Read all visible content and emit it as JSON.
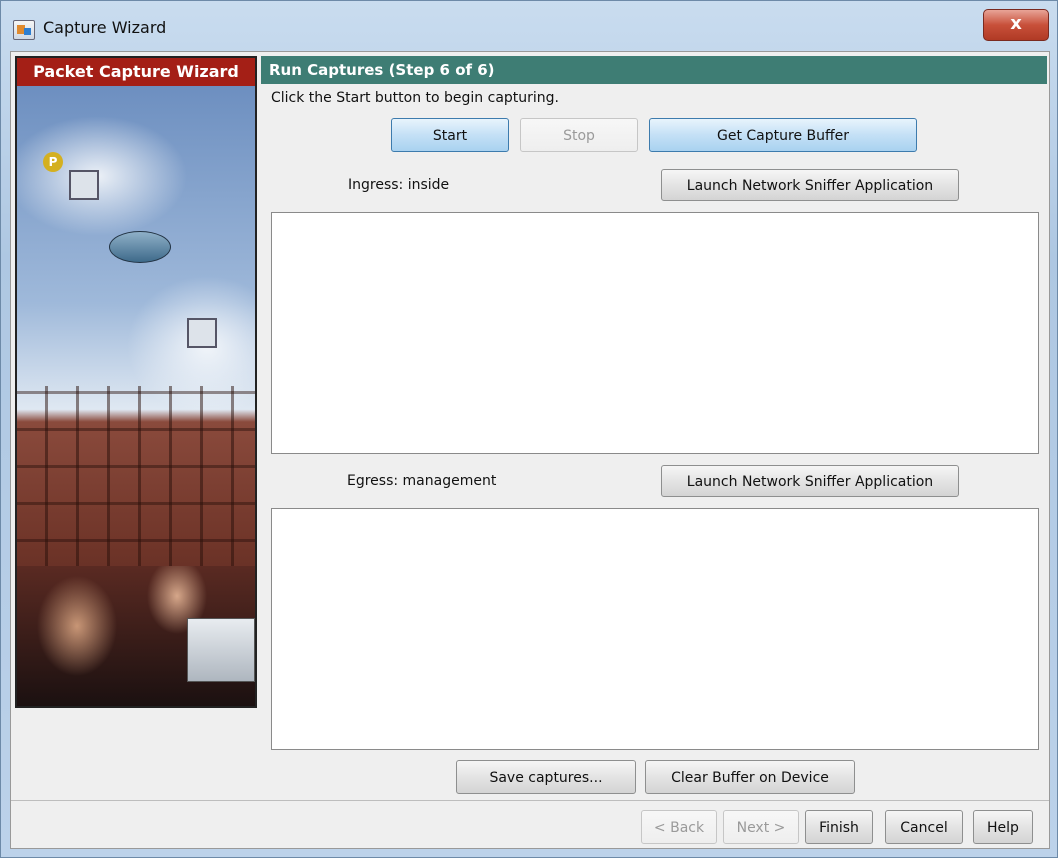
{
  "window": {
    "title": "Capture Wizard",
    "close_glyph": "x"
  },
  "left_panel": {
    "header": "Packet Capture Wizard",
    "node_badge": "P"
  },
  "step": {
    "header": "Run Captures  (Step 6 of 6)",
    "instruction": "Click the Start button to begin capturing."
  },
  "controls": {
    "start": "Start",
    "stop": "Stop",
    "get_buffer": "Get Capture Buffer"
  },
  "ingress": {
    "label": "Ingress: inside",
    "launch": "Launch Network Sniffer Application"
  },
  "egress": {
    "label": "Egress: management",
    "launch": "Launch Network Sniffer Application"
  },
  "actions": {
    "save": "Save captures...",
    "clear": "Clear Buffer on Device"
  },
  "footer": {
    "back": "< Back",
    "next": "Next >",
    "finish": "Finish",
    "cancel": "Cancel",
    "help": "Help"
  },
  "colors": {
    "left_header": "#a41f16",
    "step_header": "#3e7d74",
    "accent_button": "#a9d2f0"
  }
}
